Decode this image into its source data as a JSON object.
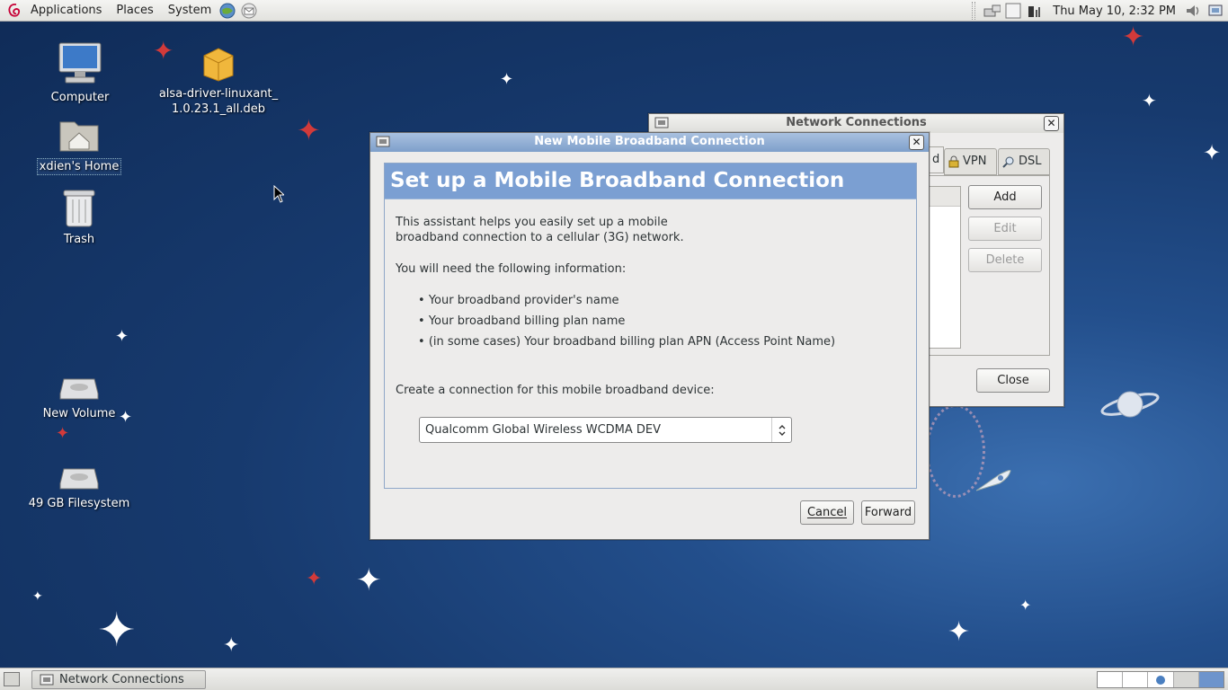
{
  "top_panel": {
    "menus": [
      "Applications",
      "Places",
      "System"
    ],
    "clock": "Thu May 10,  2:32 PM"
  },
  "desktop": {
    "icons": [
      {
        "label": "Computer"
      },
      {
        "label": "alsa-driver-linuxant_\n1.0.23.1_all.deb"
      },
      {
        "label": "xdien's Home"
      },
      {
        "label": "Trash"
      },
      {
        "label": "New Volume"
      },
      {
        "label": "49 GB Filesystem"
      }
    ]
  },
  "network_window": {
    "title": "Network Connections",
    "tabs": [
      "d",
      "VPN",
      "DSL"
    ],
    "buttons": {
      "add": "Add",
      "edit": "Edit",
      "delete": "Delete",
      "close": "Close"
    }
  },
  "dialog": {
    "title": "New Mobile Broadband Connection",
    "heading": "Set up a Mobile Broadband Connection",
    "intro_line1": "This assistant helps you easily set up a mobile",
    "intro_line2": "broadband connection to a cellular (3G) network.",
    "need_info": "You will need the following information:",
    "bullets": [
      "Your broadband provider's name",
      "Your broadband billing plan name",
      "(in some cases) Your broadband billing plan APN (Access Point Name)"
    ],
    "device_label": "Create a connection for this mobile broadband device:",
    "device_selected": "Qualcomm Global Wireless WCDMA DEV",
    "cancel": "Cancel",
    "forward": "Forward"
  },
  "taskbar": {
    "items": [
      "Network Connections"
    ]
  }
}
